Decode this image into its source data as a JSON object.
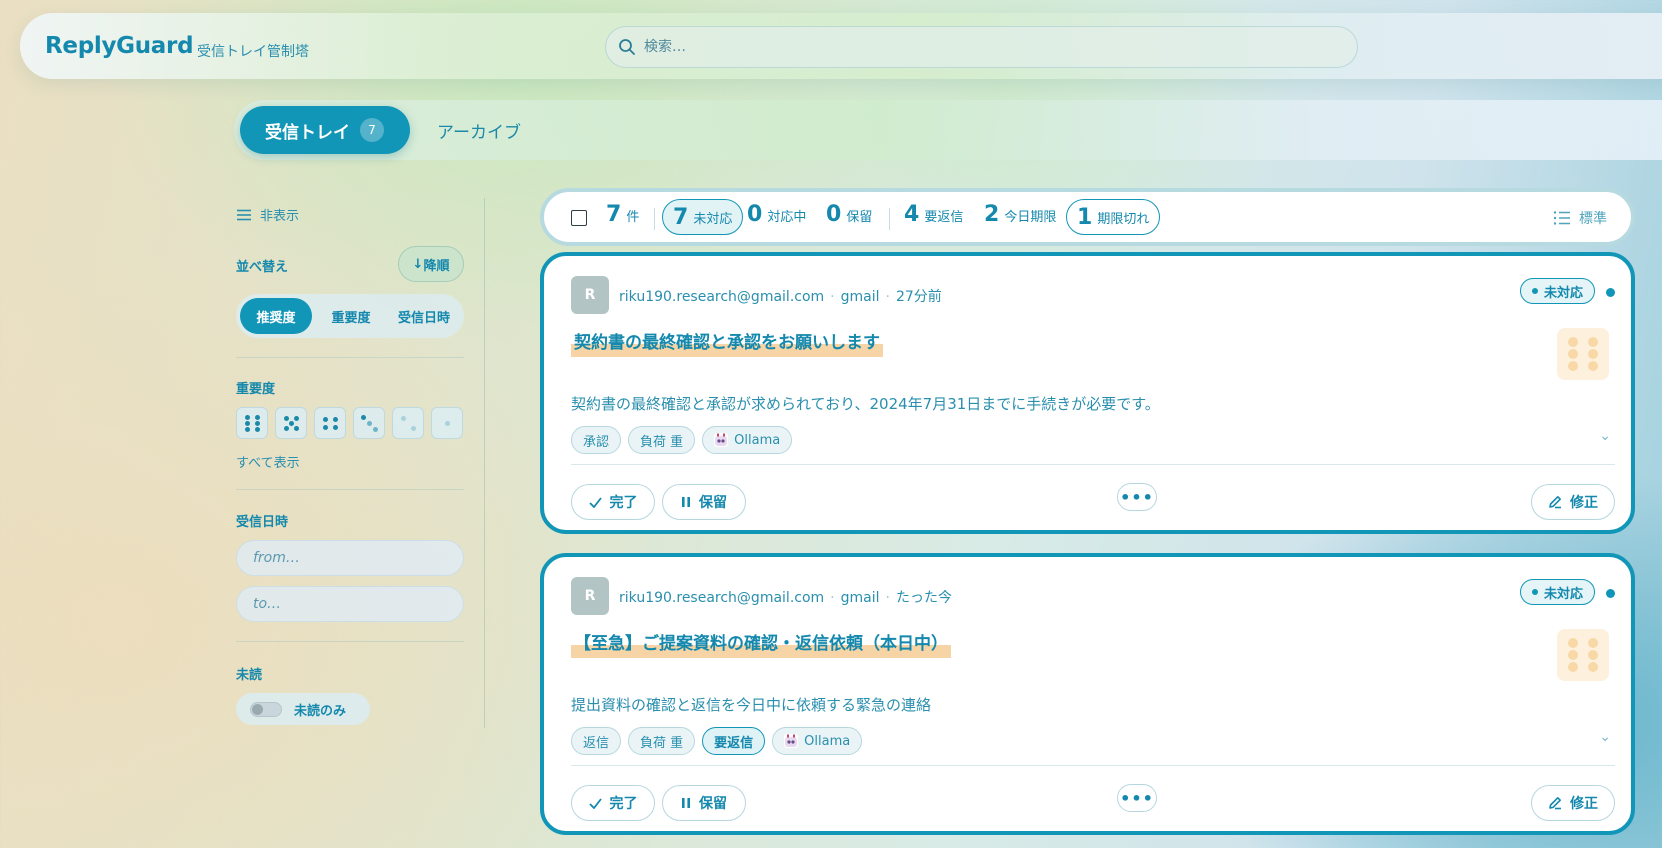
{
  "header": {
    "brand": "ReplyGuard",
    "subtitle": "受信トレイ管制塔",
    "search_placeholder": "検索…"
  },
  "tabs": [
    {
      "label": "受信トレイ",
      "count": "7",
      "active": true
    },
    {
      "label": "アーカイブ",
      "active": false
    }
  ],
  "sidebar": {
    "hide_label": "非表示",
    "sort_title": "並べ替え",
    "sort_direction": "降順",
    "sort_options": [
      "推奨度",
      "重要度",
      "受信日時"
    ],
    "sort_selected": "推奨度",
    "importance_title": "重要度",
    "importance_levels": [
      6,
      5,
      4,
      3,
      2,
      1
    ],
    "show_all": "すべて表示",
    "date_title": "受信日時",
    "date_from_placeholder": "from…",
    "date_to_placeholder": "to…",
    "unread_title": "未読",
    "unread_only_label": "未読のみ",
    "unread_only_on": false
  },
  "stats": {
    "total_n": "7",
    "total_l": "件",
    "unhandled_n": "7",
    "unhandled_l": "未対応",
    "in_progress_n": "0",
    "in_progress_l": "対応中",
    "hold_n": "0",
    "hold_l": "保留",
    "needs_reply_n": "4",
    "needs_reply_l": "要返信",
    "due_today_n": "2",
    "due_today_l": "今日期限",
    "overdue_n": "1",
    "overdue_l": "期限切れ",
    "density_label": "標準"
  },
  "emails": [
    {
      "avatar": "R",
      "from": "riku190.research@gmail.com",
      "source": "gmail",
      "time": "27分前",
      "status": "未対応",
      "subject": "契約書の最終確認と承認をお願いします",
      "summary": "契約書の最終確認と承認が求められており、2024年7月31日までに手続きが必要です。",
      "importance": 6,
      "tags": [
        "承認",
        "負荷 重"
      ],
      "model_tag": "Ollama",
      "done_label": "完了",
      "hold_label": "保留",
      "more_label": "•••",
      "edit_label": "修正"
    },
    {
      "avatar": "R",
      "from": "riku190.research@gmail.com",
      "source": "gmail",
      "time": "たった今",
      "status": "未対応",
      "subject": "【至急】ご提案資料の確認・返信依頼（本日中）",
      "summary": "提出資料の確認と返信を今日中に依頼する緊急の連絡",
      "importance": 6,
      "tags": [
        "返信",
        "負荷 重"
      ],
      "strong_tag": "要返信",
      "model_tag": "Ollama",
      "done_label": "完了",
      "hold_label": "保留",
      "more_label": "•••",
      "edit_label": "修正"
    }
  ],
  "colors": {
    "accent": "#1296b8",
    "highlight": "#f4cd96",
    "importance_badge": "#fdf0dd"
  }
}
